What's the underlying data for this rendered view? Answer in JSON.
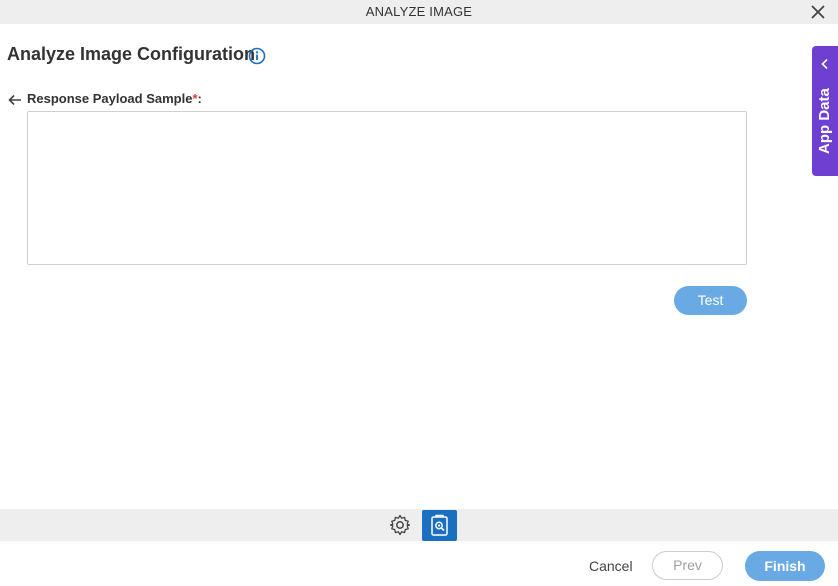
{
  "window": {
    "title": "ANALYZE IMAGE",
    "close_icon": "close-icon"
  },
  "heading": {
    "title": "Analyze Image Configuration",
    "info_icon": "info-icon"
  },
  "field": {
    "label": "Response Payload Sample",
    "required_mark": "*",
    "suffix": ":",
    "value": "",
    "placeholder": ""
  },
  "buttons": {
    "test": "Test"
  },
  "app_data_tab": {
    "label": "App Data",
    "icon": "chevron-left-icon"
  },
  "toolbar": {
    "items": [
      "gear-icon",
      "analyze-image-icon"
    ],
    "active": "analyze-image-icon"
  },
  "footer": {
    "cancel": "Cancel",
    "prev": "Prev",
    "finish": "Finish"
  },
  "colors": {
    "accent": "#1a6fc0",
    "button_blue": "#6aaae4",
    "app_data_purple": "#6e3fd1",
    "required_red": "#e53935"
  }
}
